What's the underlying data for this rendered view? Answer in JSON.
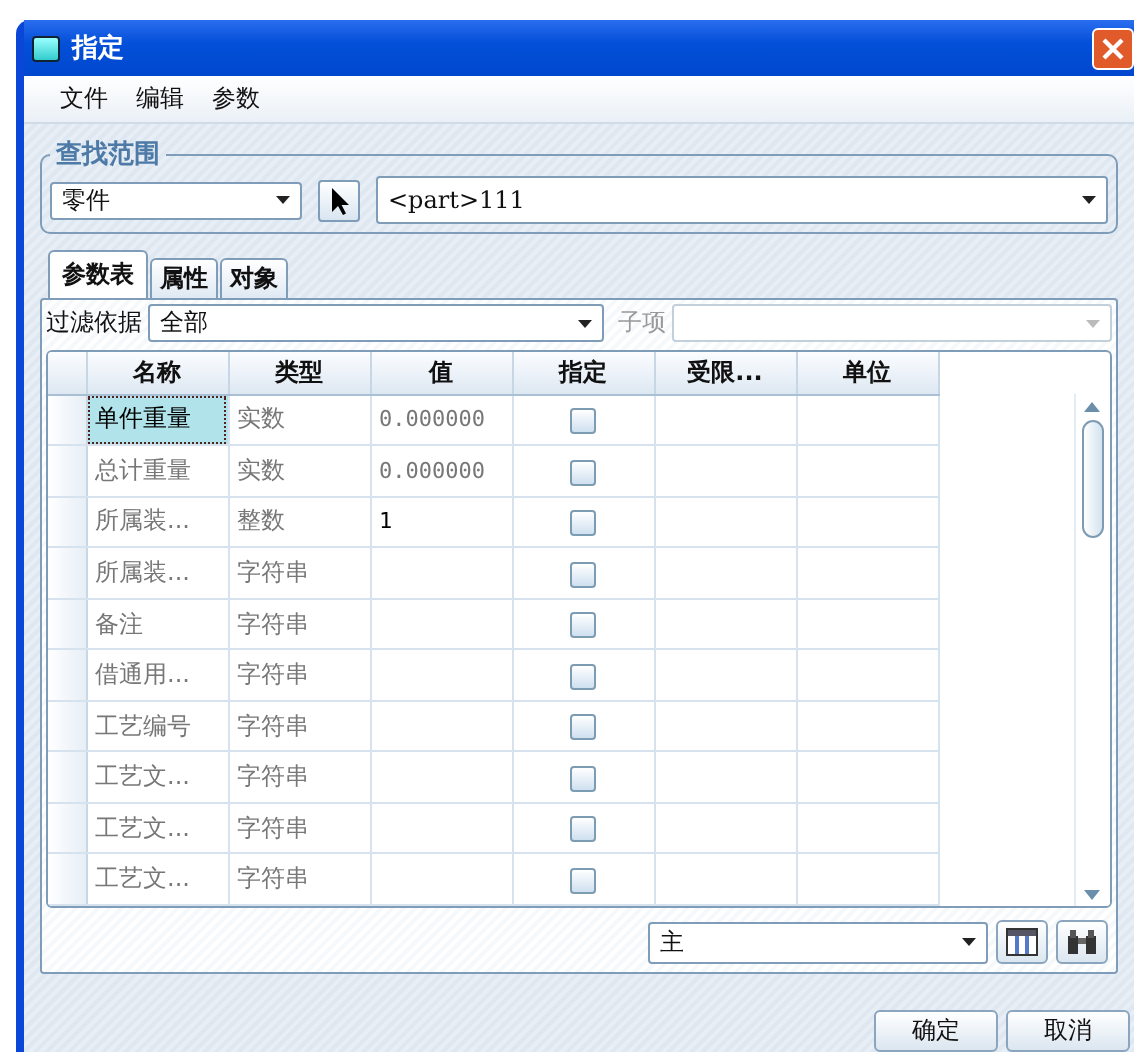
{
  "window": {
    "title": "指定"
  },
  "menu": [
    "文件",
    "编辑",
    "参数"
  ],
  "search_scope": {
    "title": "查找范围",
    "scope": "零件",
    "target": "<part>111"
  },
  "tabs": [
    {
      "label": "参数表",
      "selected": true
    },
    {
      "label": "属性",
      "selected": false
    },
    {
      "label": "对象",
      "selected": false
    }
  ],
  "filter": {
    "label": "过滤依据",
    "value": "全部",
    "sub_label": "子项"
  },
  "table": {
    "columns": [
      "名称",
      "类型",
      "值",
      "指定",
      "受限...",
      "单位"
    ],
    "rows": [
      {
        "name": "单件重量",
        "type": "实数",
        "value": "0.000000",
        "value_disabled": true,
        "checked": false,
        "selected": true
      },
      {
        "name": "总计重量",
        "type": "实数",
        "value": "0.000000",
        "value_disabled": true,
        "checked": false,
        "selected": false
      },
      {
        "name": "所属装...",
        "type": "整数",
        "value": "1",
        "value_disabled": false,
        "checked": false,
        "selected": false
      },
      {
        "name": "所属装...",
        "type": "字符串",
        "checked": false,
        "selected": false
      },
      {
        "name": "备注",
        "type": "字符串",
        "checked": false,
        "selected": false
      },
      {
        "name": "借通用...",
        "type": "字符串",
        "checked": false,
        "selected": false
      },
      {
        "name": "工艺编号",
        "type": "字符串",
        "checked": false,
        "selected": false
      },
      {
        "name": "工艺文...",
        "type": "字符串",
        "checked": false,
        "selected": false
      },
      {
        "name": "工艺文...",
        "type": "字符串",
        "checked": false,
        "selected": false
      },
      {
        "name": "工艺文...",
        "type": "字符串",
        "checked": false,
        "selected": false
      }
    ]
  },
  "view_select": "主",
  "buttons": [
    "确定",
    "取消"
  ]
}
